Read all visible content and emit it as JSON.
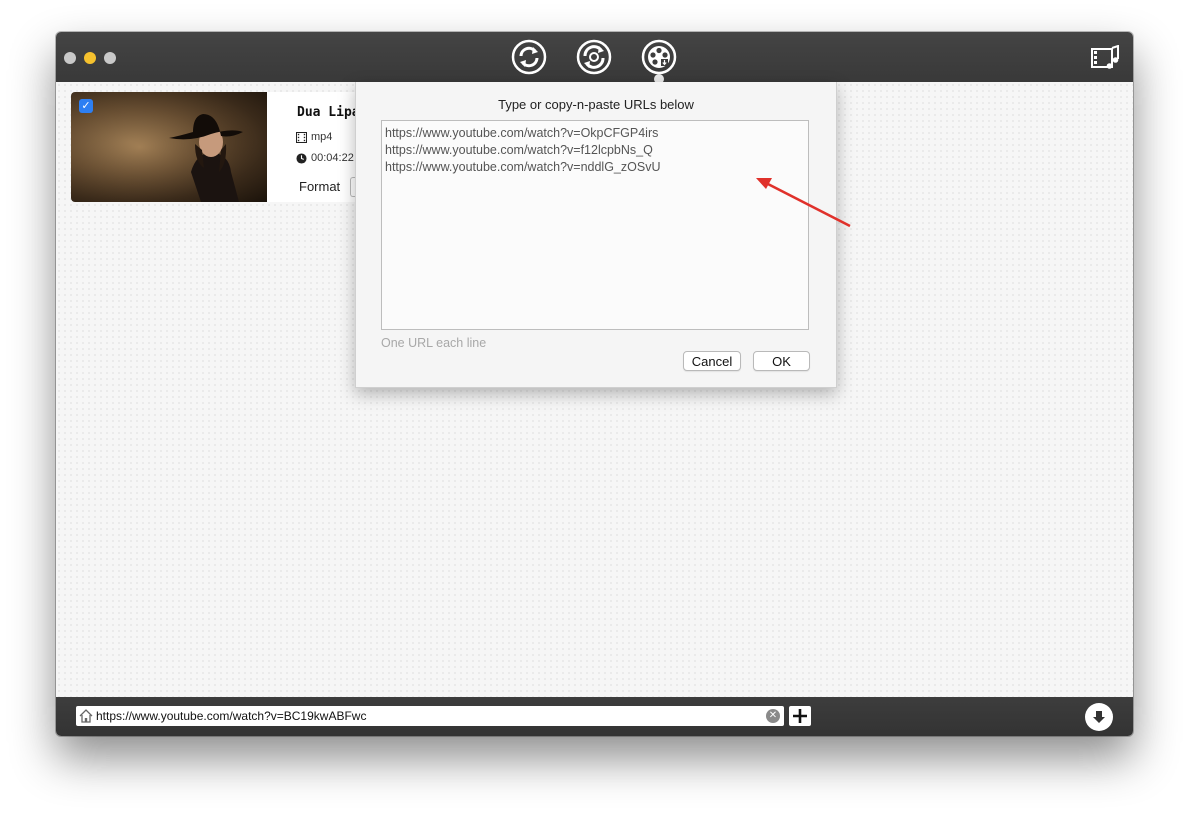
{
  "toolbar": {
    "buttons": [
      {
        "name": "convert-icon"
      },
      {
        "name": "reconvert-icon"
      },
      {
        "name": "film-reel-download-icon"
      }
    ],
    "right_icon": "film-music-icon"
  },
  "item": {
    "checked": true,
    "title": "Dua Lipa",
    "format_ext": "mp4",
    "duration": "00:04:22",
    "format_label": "Format"
  },
  "popover": {
    "title": "Type or copy-n-paste URLs below",
    "urls": "https://www.youtube.com/watch?v=OkpCFGP4irs\nhttps://www.youtube.com/watch?v=f12lcpbNs_Q\nhttps://www.youtube.com/watch?v=nddlG_zOSvU",
    "hint": "One URL each line",
    "cancel_label": "Cancel",
    "ok_label": "OK"
  },
  "bottom": {
    "url_value": "https://www.youtube.com/watch?v=BC19kwABFwc"
  },
  "colors": {
    "titlebar": "#3d3d3d",
    "accent_checkbox": "#2d7ff3",
    "annotation_arrow": "#e0312b"
  }
}
